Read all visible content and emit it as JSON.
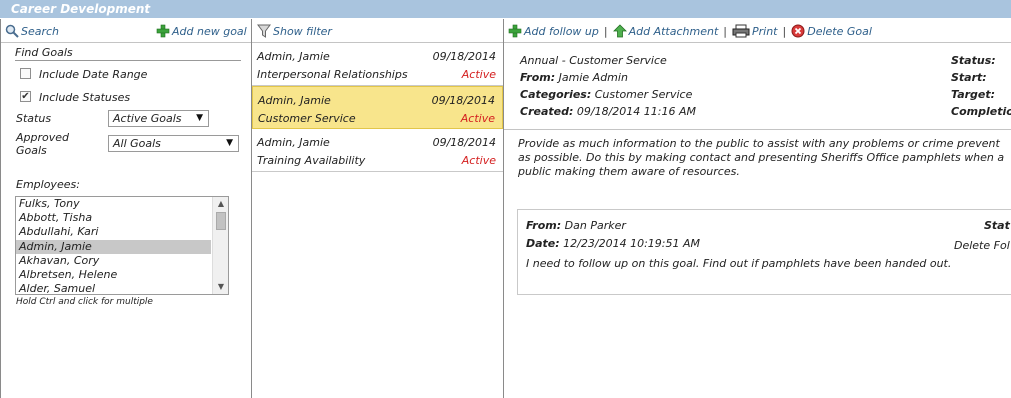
{
  "app": {
    "title": "Career Development"
  },
  "left": {
    "search_label": "Search",
    "add_goal_label": "Add new goal",
    "find_goals_label": "Find Goals",
    "include_date_range": {
      "label": "Include Date Range",
      "checked": false
    },
    "include_statuses": {
      "label": "Include Statuses",
      "checked": true
    },
    "status": {
      "label": "Status",
      "value": "Active Goals"
    },
    "approved": {
      "label_line1": "Approved",
      "label_line2": "Goals",
      "value": "All Goals"
    },
    "employees_label": "Employees:",
    "employees": [
      "Fulks, Tony",
      "Abbott, Tisha",
      "Abdullahi, Kari",
      "Admin, Jamie",
      "Akhavan, Cory",
      "Albretsen, Helene",
      "Alder, Samuel"
    ],
    "selected_employee": "Admin, Jamie",
    "hint": "Hold Ctrl and click for multiple"
  },
  "middle": {
    "show_filter_label": "Show filter",
    "goals": [
      {
        "name": "Admin, Jamie",
        "date": "09/18/2014",
        "title": "Interpersonal Relationships",
        "status": "Active"
      },
      {
        "name": "Admin, Jamie",
        "date": "09/18/2014",
        "title": "Customer Service",
        "status": "Active"
      },
      {
        "name": "Admin, Jamie",
        "date": "09/18/2014",
        "title": "Training Availability",
        "status": "Active"
      }
    ]
  },
  "right": {
    "toolbar": {
      "add_followup": "Add follow up",
      "add_attachment": "Add Attachment",
      "print": "Print",
      "delete_goal": "Delete Goal",
      "separator": "|"
    },
    "goal": {
      "type_line": "Annual - Customer Service",
      "from_label": "From:",
      "from_value": "Jamie Admin",
      "categories_label": "Categories:",
      "categories_value": "Customer Service",
      "created_label": "Created:",
      "created_value": "09/18/2014 11:16 AM",
      "status_label": "Status:",
      "start_label": "Start:",
      "target_label": "Target:",
      "completion_label": "Completio",
      "description": [
        "Provide as much information to the public to assist with any problems or crime prevent",
        "as possible. Do this by making contact and presenting Sheriffs Office pamphlets when a",
        "public making them aware of resources."
      ]
    },
    "followup": {
      "from_label": "From:",
      "from_value": "Dan Parker",
      "date_label": "Date:",
      "date_value": "12/23/2014 10:19:51 AM",
      "status_label": "Stat",
      "delete_label": "Delete Fol",
      "text": "I need to follow up on this goal. Find out if pamphlets have been handed out."
    }
  },
  "colors": {
    "title_bar": "#a9c4de",
    "selected_row": "#f8e58c",
    "status_active": "#d42020",
    "link": "#2e5f8a"
  }
}
